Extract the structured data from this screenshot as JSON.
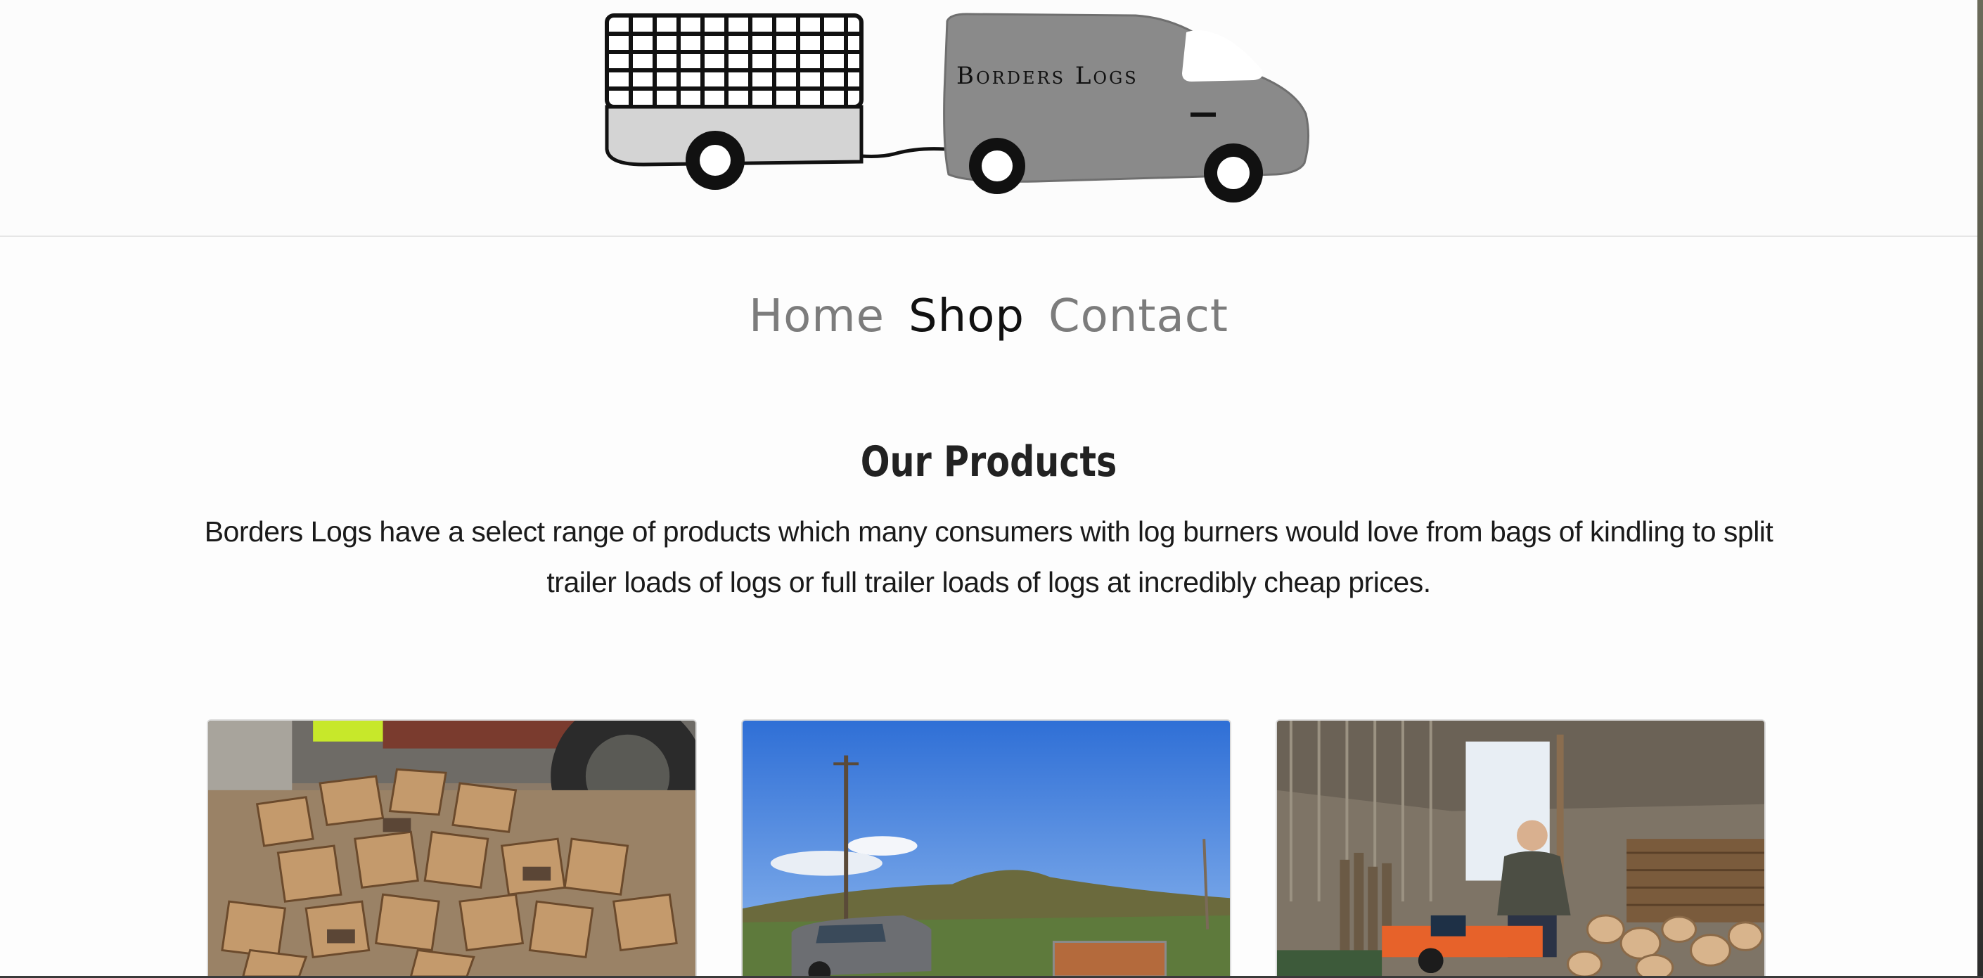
{
  "header": {
    "logo_text": "Borders Logs"
  },
  "nav": {
    "items": [
      {
        "label": "Home",
        "active": false
      },
      {
        "label": "Shop",
        "active": true
      },
      {
        "label": "Contact",
        "active": false
      }
    ]
  },
  "products": {
    "title": "Our Products",
    "description": "Borders Logs have a select range of products which many consumers with log burners would love from bags of kindling to split trailer loads of logs or full trailer loads of logs at incredibly cheap prices."
  },
  "colors": {
    "van": "#8a8a8a",
    "trailer_body": "#d4d4d4",
    "nav_inactive": "#7c7c7c",
    "nav_active": "#111111"
  }
}
